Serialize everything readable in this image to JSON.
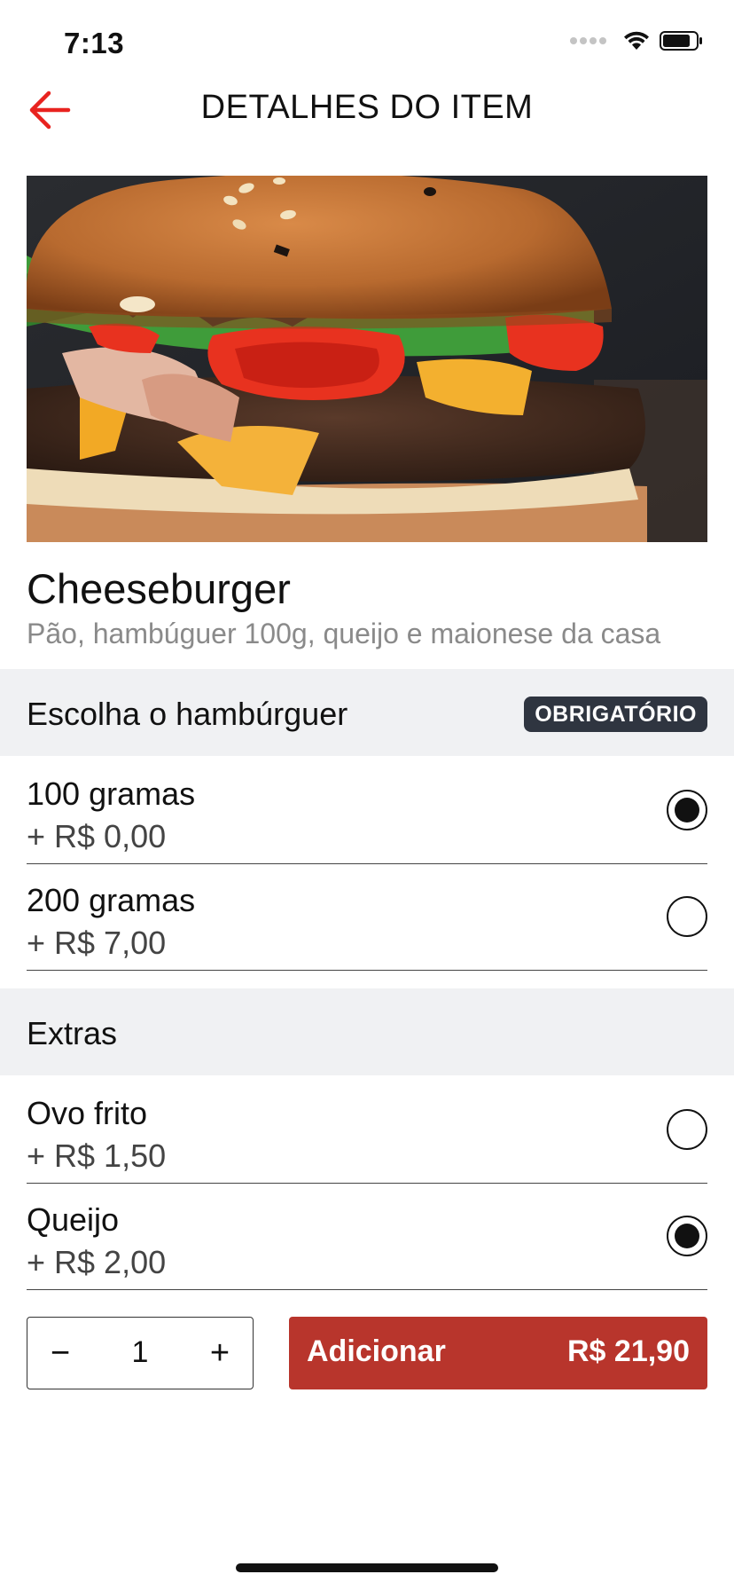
{
  "status_bar": {
    "time": "7:13"
  },
  "nav": {
    "title": "DETALHES DO ITEM",
    "back_icon": "arrow-left-icon",
    "accent_color": "#e8231f"
  },
  "item": {
    "image_alt": "cheeseburger-photo",
    "name": "Cheeseburger",
    "description": "Pão, hambúguer 100g, queijo e maionese da casa"
  },
  "sections": [
    {
      "title": "Escolha o hambúrguer",
      "badge": "OBRIGATÓRIO",
      "options": [
        {
          "name": "100 gramas",
          "price": "+ R$ 0,00",
          "selected": true
        },
        {
          "name": "200 gramas",
          "price": "+ R$ 7,00",
          "selected": false
        }
      ]
    },
    {
      "title": "Extras",
      "options": [
        {
          "name": "Ovo frito",
          "price": "+ R$ 1,50",
          "selected": false
        },
        {
          "name": "Queijo",
          "price": "+ R$ 2,00",
          "selected": true
        }
      ]
    }
  ],
  "footer": {
    "quantity": "1",
    "minus_label": "−",
    "plus_label": "+",
    "add_label": "Adicionar",
    "total": "R$ 21,90",
    "button_color": "#b8352c"
  }
}
